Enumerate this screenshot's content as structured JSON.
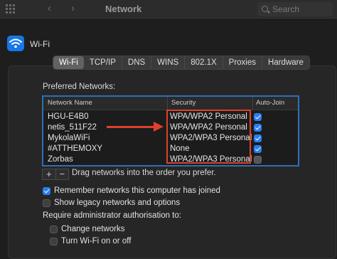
{
  "window": {
    "title": "Network"
  },
  "search": {
    "placeholder": "Search"
  },
  "service": {
    "name": "Wi-Fi"
  },
  "tabs": [
    {
      "label": "Wi-Fi",
      "active": true
    },
    {
      "label": "TCP/IP",
      "active": false
    },
    {
      "label": "DNS",
      "active": false
    },
    {
      "label": "WINS",
      "active": false
    },
    {
      "label": "802.1X",
      "active": false
    },
    {
      "label": "Proxies",
      "active": false
    },
    {
      "label": "Hardware",
      "active": false
    }
  ],
  "preferred": {
    "label": "Preferred Networks:",
    "columns": {
      "name": "Network Name",
      "security": "Security",
      "autojoin": "Auto-Join"
    },
    "rows": [
      {
        "name": "HGU-E4B0",
        "security": "WPA/WPA2 Personal",
        "autojoin": true
      },
      {
        "name": "netis_511F22",
        "security": "WPA/WPA2 Personal",
        "autojoin": true
      },
      {
        "name": "MykolaWiFi",
        "security": "WPA2/WPA3 Personal",
        "autojoin": true
      },
      {
        "name": "#ATTHEMOXY",
        "security": "None",
        "autojoin": true
      },
      {
        "name": "Zorbas",
        "security": "WPA2/WPA3 Personal",
        "autojoin": false
      }
    ],
    "add_symbol": "+",
    "remove_symbol": "−",
    "drag_hint": "Drag networks into the order you prefer."
  },
  "options": {
    "remember": {
      "label": "Remember networks this computer has joined",
      "checked": true
    },
    "legacy": {
      "label": "Show legacy networks and options",
      "checked": false
    },
    "admin_label": "Require administrator authorisation to:",
    "change_networks": {
      "label": "Change networks",
      "checked": false
    },
    "turn_wifi": {
      "label": "Turn Wi-Fi on or off",
      "checked": false
    }
  },
  "colors": {
    "accent": "#2a7ef0",
    "annotation": "#e0402b",
    "table_border": "#2e6fb5"
  },
  "icons": {
    "toolbar": [
      "grid-icon",
      "back-arrow-icon",
      "forward-arrow-icon",
      "search-icon"
    ],
    "service": "wifi-icon",
    "annotation": "arrow-right-icon"
  }
}
